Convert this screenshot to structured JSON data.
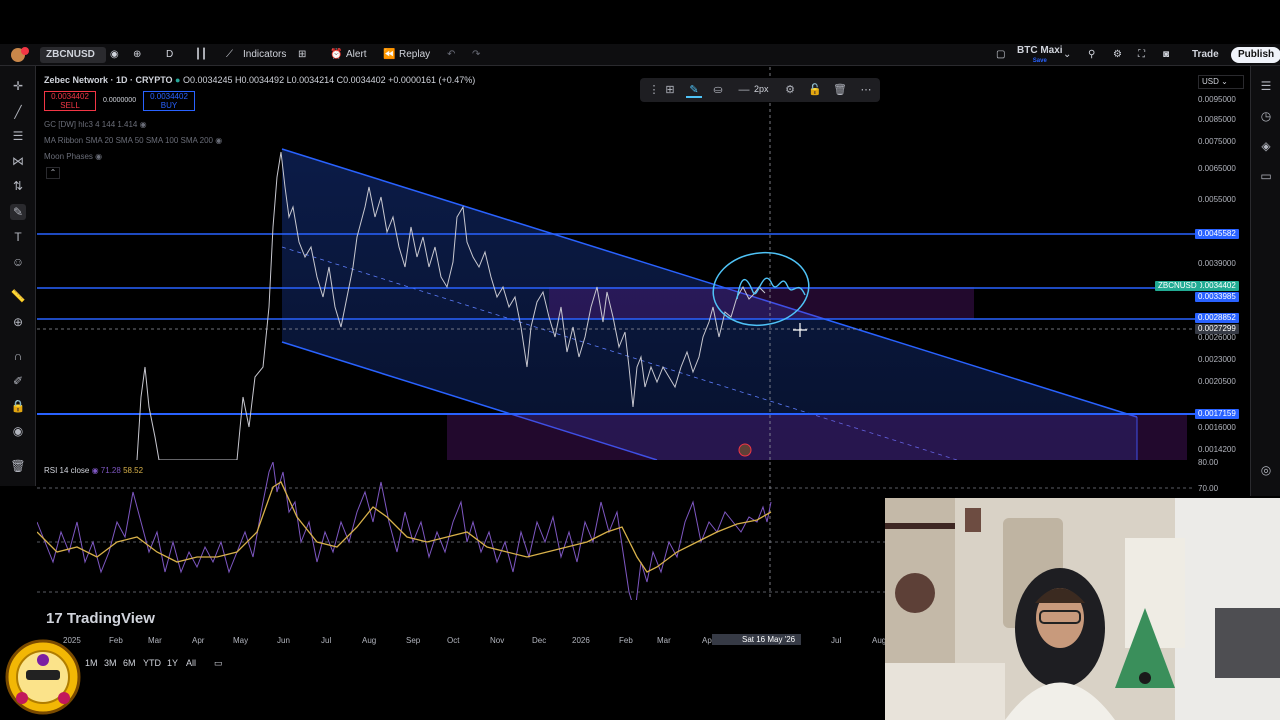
{
  "topbar": {
    "symbol": "ZBCNUSD",
    "interval": "D",
    "indicators": "Indicators",
    "alert": "Alert",
    "replay": "Replay",
    "layout_name": "BTC Maxi",
    "layout_status": "Save",
    "trade": "Trade",
    "publish": "Publish"
  },
  "legend": {
    "title": "Zebec Network · 1D · CRYPTO",
    "ohlc": "O0.0034245 H0.0034492 L0.0034214 C0.0034402 +0.0000161 (+0.47%)",
    "sell_price": "0.0034402",
    "sell_label": "SELL",
    "spread": "0.0000000",
    "buy_price": "0.0034402",
    "buy_label": "BUY",
    "ind1": "GC [DW] hlc3 4 144 1.414",
    "ind2": "MA Ribbon SMA 20 SMA 50 SMA 100 SMA 200",
    "ind3": "Moon Phases",
    "rsi_name": "RSI 14 close",
    "rsi_v1": "71.28",
    "rsi_v2": "58.52"
  },
  "drawing_toolbar": {
    "width_label": "2px"
  },
  "price_axis": {
    "currency": "USD",
    "labels": [
      "0.0095000",
      "0.0085000",
      "0.0075000",
      "0.0065000",
      "0.0055000",
      "0.0039000",
      "0.0026000",
      "0.0023000",
      "0.0020500",
      "0.0016000",
      "0.0014200"
    ],
    "tag_hline_top": "0.0045582",
    "tag_symbol_name": "ZBCNUSD",
    "tag_last": "0.0034402",
    "tag_countdown": "0.0033985",
    "tag_hline_mid": "0.0028852",
    "tag_hline_mid2": "0.0027299",
    "tag_hline_low": "0.0017159",
    "rsi_labels": [
      "80.00",
      "70.00"
    ]
  },
  "time_axis": {
    "labels": [
      "2025",
      "Feb",
      "Mar",
      "Apr",
      "May",
      "Jun",
      "Jul",
      "Aug",
      "Sep",
      "Oct",
      "Nov",
      "Dec",
      "2026",
      "Feb",
      "Mar",
      "Apr",
      "Jul",
      "Aug"
    ],
    "cursor_date": "Sat 16 May '26"
  },
  "range_bar": [
    "1M",
    "3M",
    "6M",
    "YTD",
    "1Y",
    "All"
  ],
  "brand": "TradingView",
  "colors": {
    "channel": "#2962ff",
    "accent": "#2196f3",
    "rsi_line": "#7e57c2",
    "rsi_ma": "#d8b14a",
    "annotation": "#4fc3f7"
  }
}
